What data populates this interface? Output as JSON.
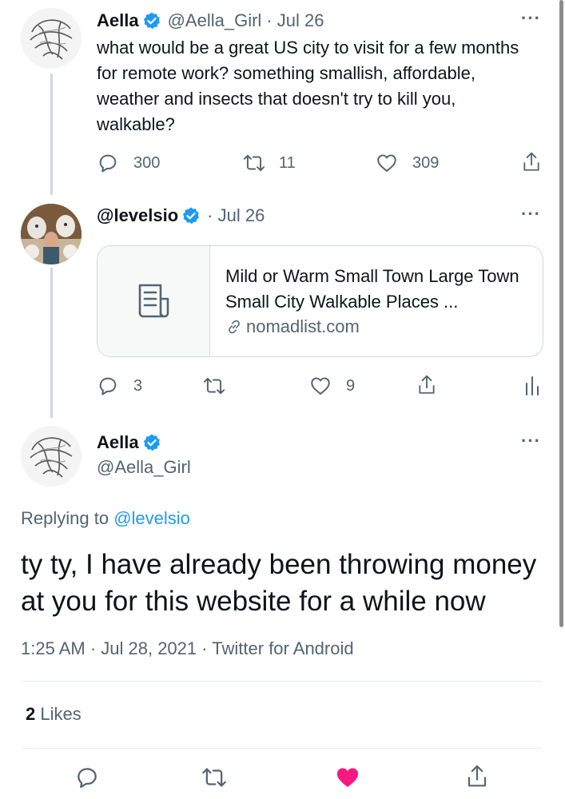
{
  "tweet1": {
    "display_name": "Aella",
    "handle": "@Aella_Girl",
    "time": "· Jul 26",
    "text": "what would be a great US city to visit for a few months for remote work? something smallish, affordable, weather and insects that doesn't try to kill you, walkable?",
    "replies": "300",
    "retweets": "11",
    "likes": "309",
    "more": "···"
  },
  "tweet2": {
    "handle": "@levelsio",
    "time": "· Jul 26",
    "card_title": "Mild or Warm Small Town Large Town Small City Walkable Places ...",
    "card_domain": "nomadlist.com",
    "replies": "3",
    "likes": "9",
    "more": "···"
  },
  "main_tweet": {
    "display_name": "Aella",
    "handle": "@Aella_Girl",
    "replying_prefix": "Replying to",
    "replying_to": "@levelsio",
    "text": "ty ty, I have already been throwing money at you for this website for a while now",
    "timestamp": "1:25 AM · Jul 28, 2021 · Twitter for Android",
    "likes_count": "2",
    "likes_label": "Likes",
    "more": "···"
  },
  "colors": {
    "accent": "#1d9bf0",
    "like_active": "#f91880",
    "muted": "#536471"
  },
  "icons": [
    "reply-icon",
    "retweet-icon",
    "like-icon",
    "share-icon",
    "analytics-icon",
    "verified-icon",
    "article-icon",
    "link-icon",
    "more-icon"
  ]
}
